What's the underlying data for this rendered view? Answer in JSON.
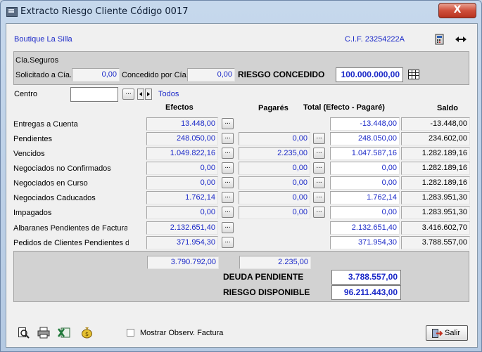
{
  "window": {
    "title": "Extracto Riesgo Cliente Código 0017",
    "close": "X"
  },
  "client": {
    "name": "Boutique La Silla",
    "cif": "C.I.F. 23254222A"
  },
  "insurance": {
    "group_label": "Cía.Seguros",
    "solicitado_label": "Solicitado a Cía.",
    "solicitado_value": "0,00",
    "concedido_label": "Concedido por Cía.",
    "concedido_value": "0,00",
    "riesgo_label": "RIESGO CONCEDIDO",
    "riesgo_value": "100.000.000,00"
  },
  "centro": {
    "label": "Centro",
    "value": "",
    "todos": "Todos"
  },
  "headers": {
    "efectos": "Efectos",
    "pagares": "Pagarés",
    "total": "Total (Efecto - Pagaré)",
    "saldo": "Saldo"
  },
  "rows": [
    {
      "label": "Entregas a Cuenta",
      "efectos": "13.448,00",
      "pagares": "",
      "total": "-13.448,00",
      "saldo": "-13.448,00"
    },
    {
      "label": "Pendientes",
      "efectos": "248.050,00",
      "pagares": "0,00",
      "total": "248.050,00",
      "saldo": "234.602,00"
    },
    {
      "label": "Vencidos",
      "efectos": "1.049.822,16",
      "pagares": "2.235,00",
      "total": "1.047.587,16",
      "saldo": "1.282.189,16"
    },
    {
      "label": "Negociados no Confirmados",
      "efectos": "0,00",
      "pagares": "0,00",
      "total": "0,00",
      "saldo": "1.282.189,16"
    },
    {
      "label": "Negociados en Curso",
      "efectos": "0,00",
      "pagares": "0,00",
      "total": "0,00",
      "saldo": "1.282.189,16"
    },
    {
      "label": "Negociados Caducados",
      "efectos": "1.762,14",
      "pagares": "0,00",
      "total": "1.762,14",
      "saldo": "1.283.951,30"
    },
    {
      "label": "Impagados",
      "efectos": "0,00",
      "pagares": "0,00",
      "total": "0,00",
      "saldo": "1.283.951,30"
    },
    {
      "label": "Albaranes Pendientes de Facturar",
      "efectos": "2.132.651,40",
      "pagares": "",
      "total": "2.132.651,40",
      "saldo": "3.416.602,70"
    },
    {
      "label": "Pedidos de Clientes Pendientes de",
      "efectos": "371.954,30",
      "pagares": "",
      "total": "371.954,30",
      "saldo": "3.788.557,00"
    }
  ],
  "totals": {
    "efectos": "3.790.792,00",
    "pagares": "2.235,00",
    "deuda_label": "DEUDA PENDIENTE",
    "deuda_value": "3.788.557,00",
    "disponible_label": "RIESGO DISPONIBLE",
    "disponible_value": "96.211.443,00"
  },
  "footer": {
    "mostrar_label": "Mostrar Observ. Factura",
    "salir": "Salir"
  },
  "dots_label": "...",
  "icons": [
    "preview-icon",
    "printer-icon",
    "excel-icon",
    "money-bag-icon",
    "calculator-icon",
    "expand-arrows-icon",
    "table-icon",
    "exit-icon"
  ]
}
